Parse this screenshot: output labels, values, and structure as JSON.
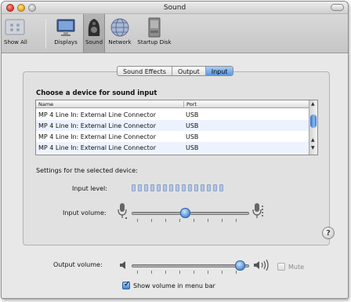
{
  "window": {
    "title": "Sound"
  },
  "toolbar": {
    "items": [
      {
        "label": "Show All",
        "icon": "apple-logo-icon"
      },
      {
        "label": "Displays",
        "icon": "display-icon"
      },
      {
        "label": "Sound",
        "icon": "speaker-icon",
        "selected": true
      },
      {
        "label": "Network",
        "icon": "globe-network-icon"
      },
      {
        "label": "Startup Disk",
        "icon": "hard-disk-icon"
      }
    ]
  },
  "tabs": [
    {
      "label": "Sound Effects",
      "active": false
    },
    {
      "label": "Output",
      "active": false
    },
    {
      "label": "Input",
      "active": true
    }
  ],
  "input": {
    "heading": "Choose a device for sound input",
    "columns": {
      "name": "Name",
      "port": "Port"
    },
    "devices": [
      {
        "name": "MP 4 Line In: External Line Connector",
        "port": "USB"
      },
      {
        "name": "MP 4 Line In: External Line Connector",
        "port": "USB"
      },
      {
        "name": "MP 4 Line In: External Line Connector",
        "port": "USB"
      },
      {
        "name": "MP 4 Line In: External Line Connector",
        "port": "USB"
      }
    ],
    "settings_label": "Settings for the selected device:",
    "input_level_label": "Input level:",
    "input_level_segments": 15,
    "input_level_lit": 0,
    "input_volume_label": "Input volume:",
    "input_volume_fraction": 0.45,
    "help_glyph": "?"
  },
  "output": {
    "volume_label": "Output volume:",
    "volume_fraction": 0.92,
    "mute_label": "Mute",
    "mute_checked": false,
    "show_volume_label": "Show volume in menu bar",
    "show_volume_checked": true
  },
  "colors": {
    "selection_blue": "#5a98e0",
    "meter_idle": "#b3c7e6"
  }
}
